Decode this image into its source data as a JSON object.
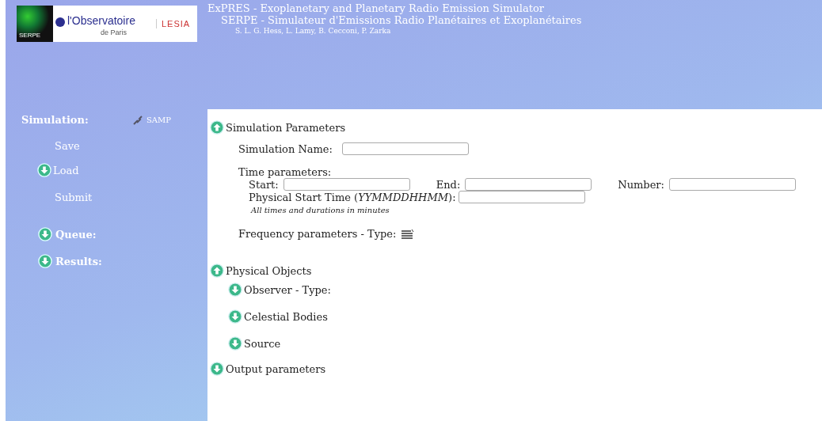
{
  "logo": {
    "serpe": "SERPE",
    "observatoire": "l'Observatoire",
    "paris": "de Paris",
    "lesia": "LESIA"
  },
  "header": {
    "title": "ExPRES - Exoplanetary and Planetary Radio Emission Simulator",
    "subtitle": "SERPE - Simulateur d'Emissions Radio Planétaires et Exoplanétaires",
    "authors": "S. L. G. Hess, L. Lamy, B. Cecconi, P. Zarka"
  },
  "sidebar": {
    "heading": "Simulation:",
    "samp": "SAMP",
    "actions": [
      {
        "label": "Save",
        "kind": "link"
      },
      {
        "label": "Load",
        "kind": "toggle",
        "expanded": false
      },
      {
        "label": "Submit",
        "kind": "link"
      }
    ],
    "sections": [
      {
        "label": "Queue:",
        "expanded": false
      },
      {
        "label": "Results:",
        "expanded": false
      }
    ]
  },
  "simulation_parameters": {
    "label": "Simulation Parameters",
    "expanded": true,
    "name_label": "Simulation Name:",
    "time_label": "Time parameters:",
    "start_label": "Start:",
    "end_label": "End:",
    "number_label": "Number:",
    "physical_start_label": "Physical Start Time (*YYMMDDHHMM*):",
    "note": "All times and durations in minutes",
    "frequency_label": "Frequency parameters - Type:"
  },
  "physical_objects": {
    "label": "Physical Objects",
    "expanded": true,
    "children": [
      {
        "label": "Observer - Type:",
        "expanded": false
      },
      {
        "label": "Celestial Bodies",
        "expanded": false
      },
      {
        "label": "Source",
        "expanded": false
      }
    ]
  },
  "output_parameters": {
    "label": "Output parameters",
    "expanded": false
  }
}
